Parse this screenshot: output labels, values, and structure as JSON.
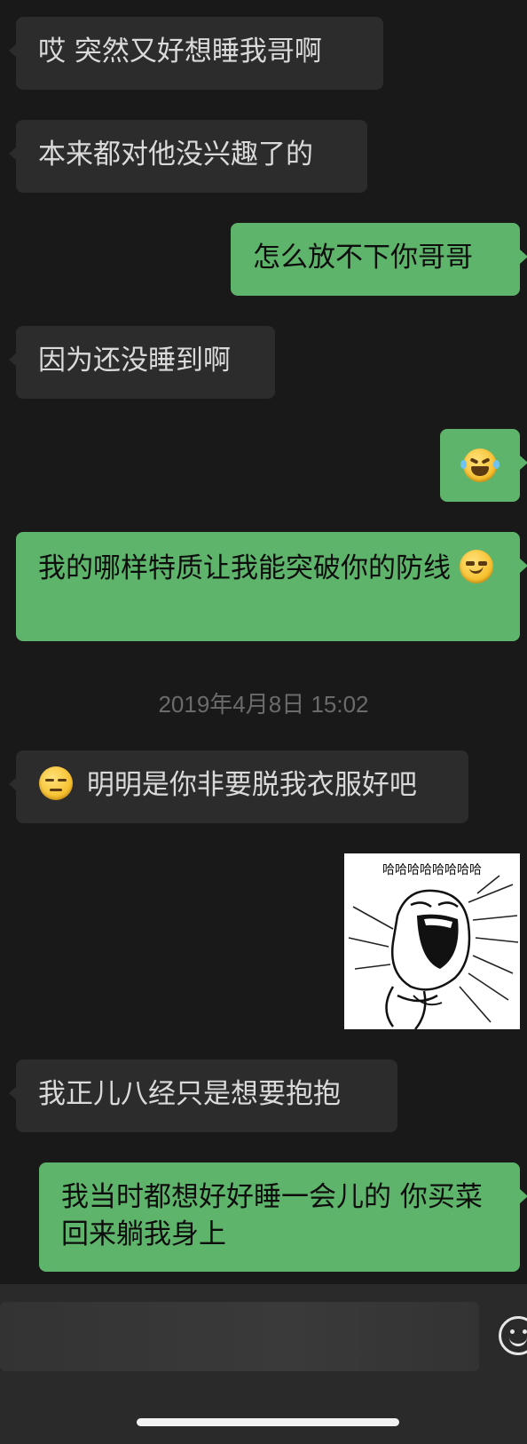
{
  "chat": {
    "messages": [
      {
        "side": "in",
        "text": "哎 突然又好想睡我哥啊"
      },
      {
        "side": "in",
        "text": "本来都对他没兴趣了的"
      },
      {
        "side": "out",
        "text": "怎么放不下你哥哥"
      },
      {
        "side": "in",
        "text": "因为还没睡到啊"
      },
      {
        "side": "out",
        "emoji": "laughing-crying-emoji"
      },
      {
        "side": "out",
        "text": "我的哪样特质让我能突破你的防线",
        "emoji_after": "smirk-emoji"
      },
      {
        "side": "in",
        "emoji_before": "unamused-emoji",
        "text": "明明是你非要脱我衣服好吧"
      },
      {
        "side": "out",
        "sticker_caption": "哈哈哈哈哈哈哈哈"
      },
      {
        "side": "in",
        "text": "我正儿八经只是想要抱抱"
      },
      {
        "side": "out",
        "text": "我当时都想好好睡一会儿的 你买菜回来躺我身上"
      }
    ],
    "timestamp": "2019年4月8日 15:02"
  },
  "input_bar": {
    "emoji_button_icon": "smiley-face-icon"
  },
  "colors": {
    "background": "#191919",
    "incoming_bubble": "#2c2c2c",
    "outgoing_bubble": "#5fb46b",
    "incoming_text": "#dadada",
    "outgoing_text": "#0d0d0d",
    "timestamp_text": "#6b6b6b"
  }
}
